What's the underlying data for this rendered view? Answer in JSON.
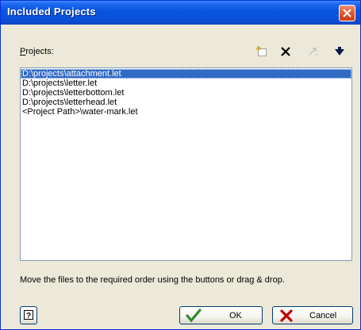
{
  "window": {
    "title": "Included Projects"
  },
  "projects": {
    "label": "Projects:",
    "items": [
      "D:\\projects\\attachment.let",
      "D:\\projects\\letter.let",
      "D:\\projects\\letterbottom.let",
      "D:\\projects\\letterhead.let",
      "<Project Path>\\water-mark.let"
    ],
    "selected_index": 0
  },
  "toolbar": {
    "icons": [
      "new-item-icon",
      "delete-icon",
      "move-up-icon",
      "move-down-icon"
    ]
  },
  "hint": "Move the files to the required order using the buttons or drag & drop.",
  "buttons": {
    "ok": "OK",
    "cancel": "Cancel",
    "help_icon": "help-icon"
  },
  "colors": {
    "titlebar": "#0a55e0",
    "selection": "#316ac5",
    "close": "#e25a30"
  }
}
